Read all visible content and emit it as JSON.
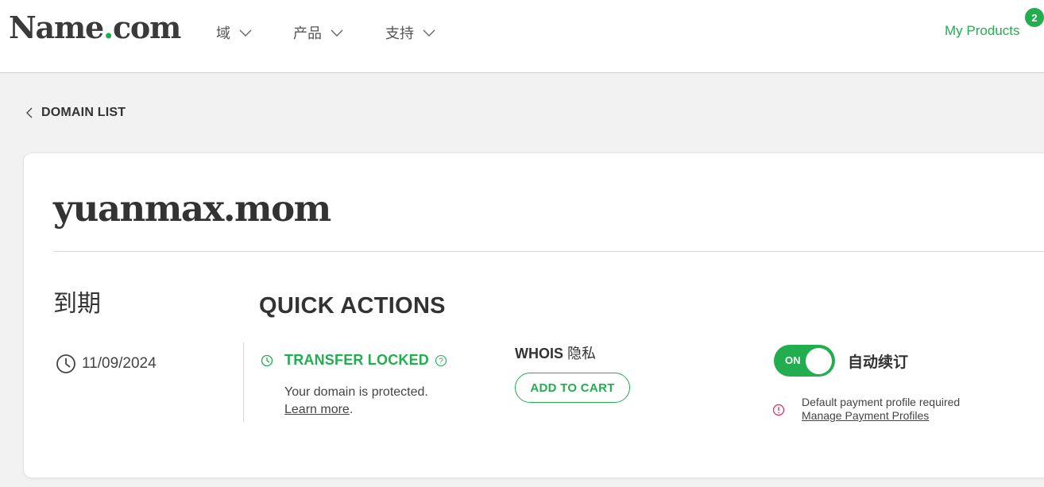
{
  "header": {
    "logo_main": "Name",
    "logo_dot": ".",
    "logo_tld": "com",
    "nav": [
      {
        "label": "域",
        "icon": "chevron-down-icon"
      },
      {
        "label": "产品",
        "icon": "chevron-down-icon"
      },
      {
        "label": "支持",
        "icon": "chevron-down-icon"
      }
    ],
    "my_products": "My Products",
    "cart_count": "2"
  },
  "breadcrumb": {
    "back_label": "DOMAIN LIST",
    "icon": "chevron-left-icon"
  },
  "domain": {
    "name": "yuanmax.mom",
    "expiration_label": "到期",
    "expiration_date": "11/09/2024",
    "expiration_icon": "clock-icon"
  },
  "quick_actions": {
    "title": "QUICK ACTIONS",
    "transfer_lock": {
      "status": "TRANSFER LOCKED",
      "description": "Your domain is protected.",
      "learn_more": "Learn more",
      "period": ".",
      "icons": [
        "clock-icon",
        "help-icon"
      ]
    },
    "whois": {
      "label": "WHOIS",
      "label_cn": "隐私",
      "button": "ADD TO CART"
    },
    "auto_renew": {
      "toggle_text": "ON",
      "enabled": true,
      "label": "自动续订",
      "warning": "Default payment profile required",
      "manage_link": "Manage Payment Profiles",
      "warning_icon": "alert-circle-icon"
    }
  },
  "colors": {
    "brand_green": "#22ad4f",
    "text_dark": "#333333",
    "warning_red": "#e0245e",
    "page_bg": "#f2f2f2"
  }
}
